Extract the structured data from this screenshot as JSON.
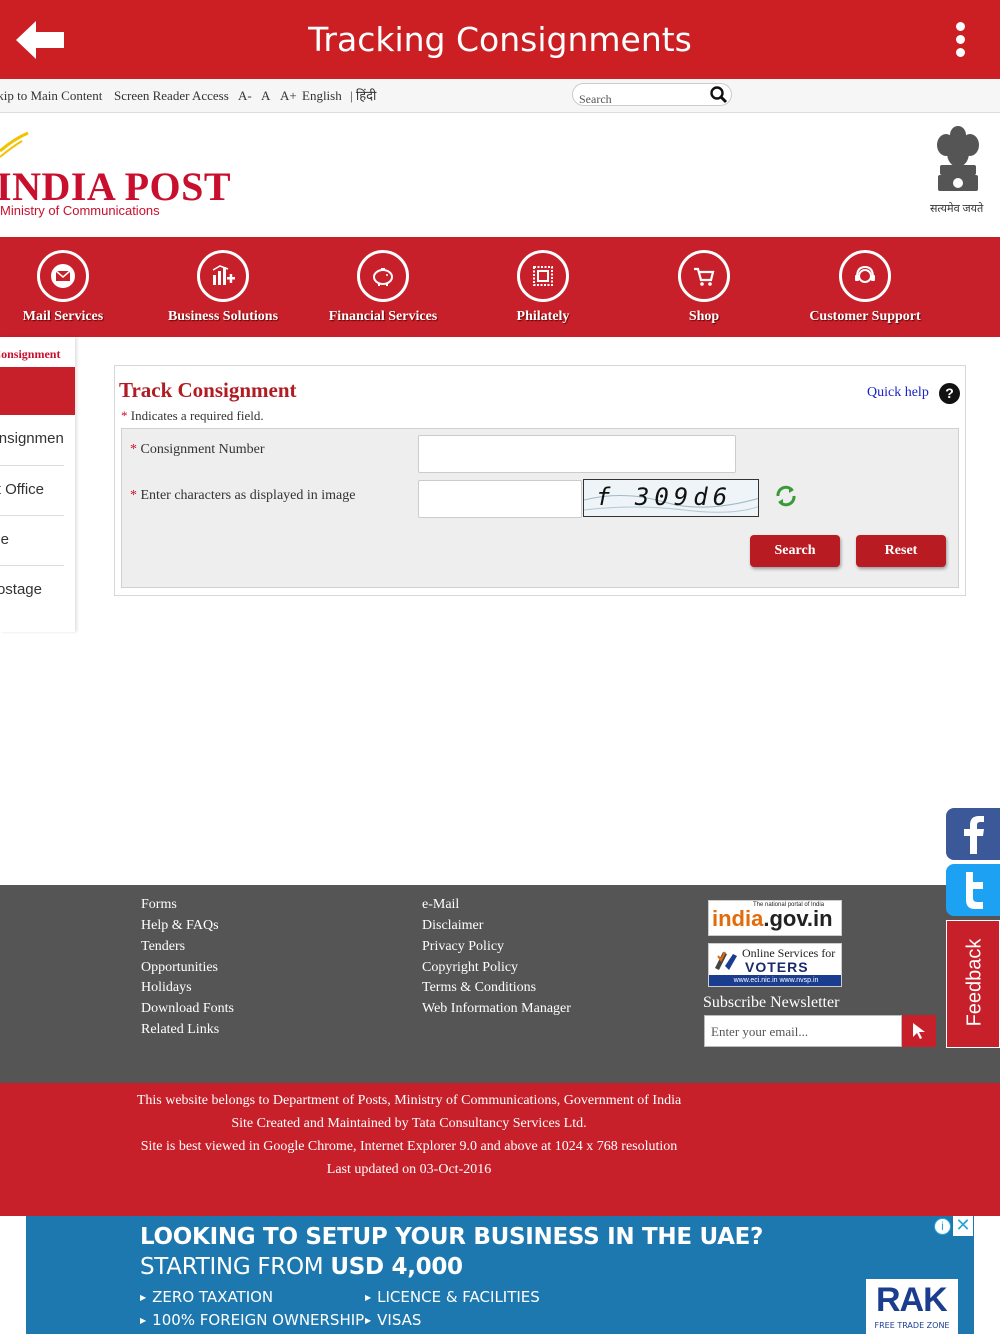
{
  "app_bar": {
    "title": "Tracking Consignments"
  },
  "utility_bar": {
    "skip_link": "Skip to Main Content",
    "screen_reader": "Screen Reader Access",
    "font_decrease": "A-",
    "font_normal": "A",
    "font_increase": "A+",
    "lang_english": "English",
    "lang_hindi": "| हिंदी",
    "search_placeholder": "Search"
  },
  "header": {
    "logo_title": "INDIA POST",
    "logo_subtitle": "Ministry of Communications",
    "emblem_motto": "सत्यमेव जयते"
  },
  "nav": {
    "items": [
      {
        "label": "Mail Services",
        "icon": "envelope-icon"
      },
      {
        "label": "Business Solutions",
        "icon": "chart-icon"
      },
      {
        "label": "Financial Services",
        "icon": "piggy-bank-icon"
      },
      {
        "label": "Philately",
        "icon": "stamp-icon"
      },
      {
        "label": "Shop",
        "icon": "cart-icon"
      },
      {
        "label": "Customer Support",
        "icon": "support-icon"
      }
    ]
  },
  "side_menu": {
    "breadcrumb": "Track Consignment",
    "items": [
      {
        "label": "Track Consignment"
      },
      {
        "label": "Locate Post Office"
      },
      {
        "label": "Pincode"
      },
      {
        "label": "Calculate Postage"
      }
    ]
  },
  "form": {
    "title": "Track Consignment",
    "required_note": "Indicates a required field.",
    "required_mark": "*",
    "quick_help": "Quick help",
    "help_glyph": "?",
    "consignment_label": "Consignment Number",
    "consignment_value": "",
    "captcha_label": "Enter characters as displayed in image",
    "captcha_value": "",
    "captcha_text": "f 309d6",
    "search_button": "Search",
    "reset_button": "Reset"
  },
  "footer": {
    "col1": [
      "Forms",
      "Help & FAQs",
      "Tenders",
      "Opportunities",
      "Holidays",
      "Download Fonts",
      "Related Links"
    ],
    "col2": [
      "e-Mail",
      "Disclaimer",
      "Privacy Policy",
      "Copyright Policy",
      "Terms & Conditions",
      "Web Information Manager"
    ],
    "india_gov_tagline": "The national portal of India",
    "india_gov_a": "india",
    "india_gov_b": ".gov.in",
    "voters_line1": "Online Services for",
    "voters_line2": "VOTERS",
    "voters_line3": "www.eci.nic.in  www.nvsp.in",
    "subscribe_title": "Subscribe Newsletter",
    "email_placeholder": "Enter your email..."
  },
  "copyright": {
    "lines": [
      "This website belongs to Department of Posts, Ministry of Communications, Government of India",
      "Site Created and Maintained by Tata Consultancy Services Ltd.",
      "Site is best viewed in Google Chrome, Internet Explorer 9.0 and above at 1024 x 768 resolution",
      "Last updated on  03-Oct-2016"
    ]
  },
  "side_widgets": {
    "feedback": "Feedback"
  },
  "ad": {
    "headline": "LOOKING TO SETUP YOUR BUSINESS IN THE UAE?",
    "subline_a": "STARTING FROM",
    "subline_b": "USD 4,000",
    "bullets": [
      "ZERO TAXATION",
      "100% FOREIGN OWNERSHIP",
      "LICENCE & FACILITIES",
      "VISAS"
    ],
    "brand": "RAK",
    "brand_sub": "FREE TRADE ZONE"
  },
  "colors": {
    "brand_red": "#cc1f24",
    "footer_grey": "#555555",
    "link_blue": "#1a23c9",
    "ad_blue": "#1d78b0"
  }
}
